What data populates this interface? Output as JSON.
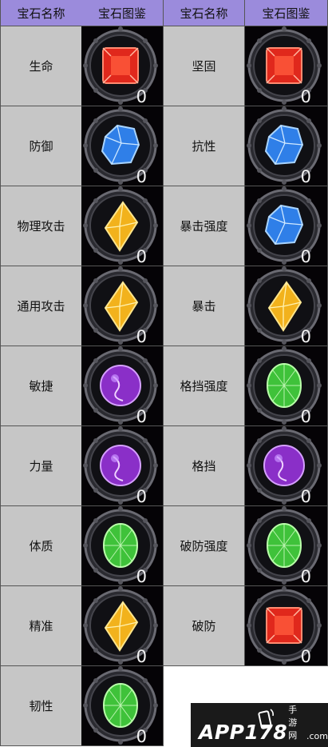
{
  "headers": [
    "宝石名称",
    "宝石图鉴",
    "宝石名称",
    "宝石图鉴"
  ],
  "rows": [
    {
      "left": {
        "name": "生命",
        "gem": "red",
        "count": "0"
      },
      "right": {
        "name": "坚固",
        "gem": "red",
        "count": "0"
      }
    },
    {
      "left": {
        "name": "防御",
        "gem": "blue",
        "count": "0"
      },
      "right": {
        "name": "抗性",
        "gem": "blue",
        "count": "0"
      }
    },
    {
      "left": {
        "name": "物理攻击",
        "gem": "yellow",
        "count": "0"
      },
      "right": {
        "name": "暴击强度",
        "gem": "blue",
        "count": "0"
      }
    },
    {
      "left": {
        "name": "通用攻击",
        "gem": "yellow",
        "count": "0"
      },
      "right": {
        "name": "暴击",
        "gem": "yellow",
        "count": "0"
      }
    },
    {
      "left": {
        "name": "敏捷",
        "gem": "purple",
        "count": "0"
      },
      "right": {
        "name": "格挡强度",
        "gem": "green",
        "count": "0"
      }
    },
    {
      "left": {
        "name": "力量",
        "gem": "purple",
        "count": "0"
      },
      "right": {
        "name": "格挡",
        "gem": "purple",
        "count": "0"
      }
    },
    {
      "left": {
        "name": "体质",
        "gem": "green",
        "count": "0"
      },
      "right": {
        "name": "破防强度",
        "gem": "green",
        "count": "0"
      }
    },
    {
      "left": {
        "name": "精准",
        "gem": "yellow",
        "count": "0"
      },
      "right": {
        "name": "破防",
        "gem": "red",
        "count": "0"
      }
    },
    {
      "left": {
        "name": "韧性",
        "gem": "green",
        "count": "0"
      },
      "right": null
    }
  ],
  "gem_colors": {
    "red": "#e0281c",
    "blue": "#2f7fe8",
    "yellow": "#f2b21c",
    "purple": "#8a2fc8",
    "green": "#3fc23a"
  },
  "watermark": {
    "brand": "APP178",
    "suffix": "手游网",
    "domain": ".com"
  }
}
